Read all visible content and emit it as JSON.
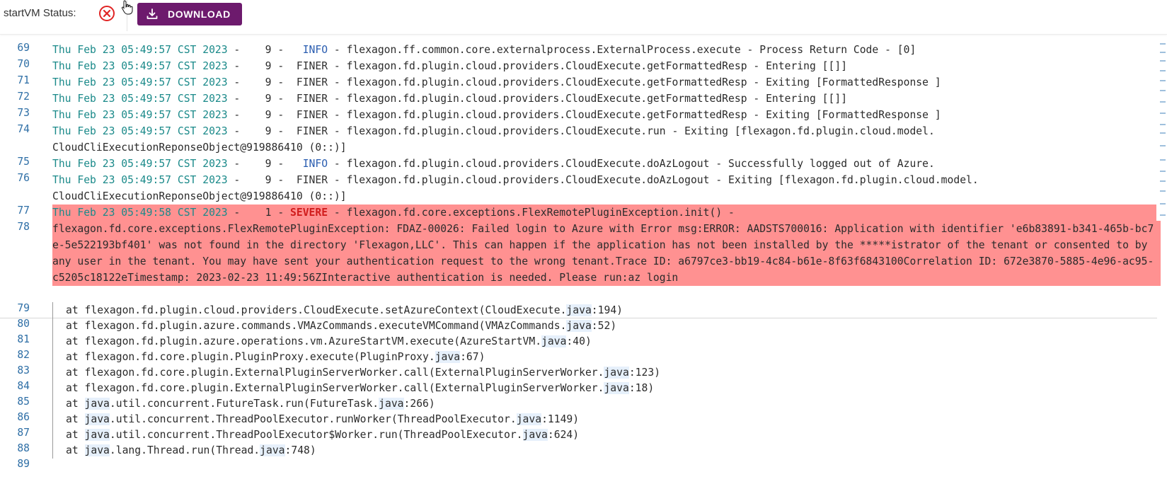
{
  "header": {
    "status_label": "startVM Status:",
    "status_icon": "error-circle-x-icon",
    "download_label": "DOWNLOAD",
    "download_icon": "download-icon"
  },
  "colors": {
    "brand": "#6d1a6d",
    "error": "#e02424",
    "severe_bg": "#ff9191",
    "timestamp": "#1b8a8a",
    "line_number": "#2f6fa6"
  },
  "log": {
    "lines": [
      {
        "n": "69",
        "ts": "Thu Feb 23 05:49:57 CST 2023",
        "thread": " -    9 - ",
        "level": "  INFO",
        "msg": " - flexagon.ff.common.core.externalprocess.ExternalProcess.execute - Process Return Code - [0]"
      },
      {
        "n": "70",
        "ts": "Thu Feb 23 05:49:57 CST 2023",
        "thread": " -    9 - ",
        "level": " FINER",
        "msg": " - flexagon.fd.plugin.cloud.providers.CloudExecute.getFormattedResp - Entering [[]]"
      },
      {
        "n": "71",
        "ts": "Thu Feb 23 05:49:57 CST 2023",
        "thread": " -    9 - ",
        "level": " FINER",
        "msg": " - flexagon.fd.plugin.cloud.providers.CloudExecute.getFormattedResp - Exiting [FormattedResponse ]"
      },
      {
        "n": "72",
        "ts": "Thu Feb 23 05:49:57 CST 2023",
        "thread": " -    9 - ",
        "level": " FINER",
        "msg": " - flexagon.fd.plugin.cloud.providers.CloudExecute.getFormattedResp - Entering [[]]"
      },
      {
        "n": "73",
        "ts": "Thu Feb 23 05:49:57 CST 2023",
        "thread": " -    9 - ",
        "level": " FINER",
        "msg": " - flexagon.fd.plugin.cloud.providers.CloudExecute.getFormattedResp - Exiting [FormattedResponse ]"
      },
      {
        "n": "74",
        "ts": "Thu Feb 23 05:49:57 CST 2023",
        "thread": " -    9 - ",
        "level": " FINER",
        "msg": " - flexagon.fd.plugin.cloud.providers.CloudExecute.run - Exiting [flexagon.fd.plugin.cloud.model.",
        "cont": "CloudCliExecutionReponseObject@919886410 (0::)]"
      },
      {
        "n": "75",
        "ts": "Thu Feb 23 05:49:57 CST 2023",
        "thread": " -    9 - ",
        "level": "  INFO",
        "msg": " - flexagon.fd.plugin.cloud.providers.CloudExecute.doAzLogout - Successfully logged out of Azure."
      },
      {
        "n": "76",
        "ts": "Thu Feb 23 05:49:57 CST 2023",
        "thread": " -    9 - ",
        "level": " FINER",
        "msg": " - flexagon.fd.plugin.cloud.providers.CloudExecute.doAzLogout - Exiting [flexagon.fd.plugin.cloud.model.",
        "cont": "CloudCliExecutionReponseObject@919886410 (0::)]"
      },
      {
        "n": "77",
        "ts": "Thu Feb 23 05:49:58 CST 2023",
        "thread": " -    1 - ",
        "level": "SEVERE",
        "msg": " - flexagon.fd.core.exceptions.FlexRemotePluginException.init() -"
      }
    ],
    "severe_detail": {
      "n": "78",
      "text": "flexagon.fd.core.exceptions.FlexRemotePluginException: FDAZ-00026: Failed login to Azure with Error msg:ERROR: AADSTS700016: Application with identifier 'e6b83891-b341-465b-bc7e-5e522193bf401' was not found in the directory 'Flexagon,LLC'. This can happen if the application has not been installed by the *****istrator of the tenant or consented to by any user in the tenant. You may have sent your authentication request to the wrong tenant.Trace ID: a6797ce3-bb19-4c84-b61e-8f63f6843100Correlation ID: 672e3870-5885-4e96-ac95-c5205c18122eTimestamp: 2023-02-23 11:49:56ZInteractive authentication is needed. Please run:az login"
    },
    "stack": [
      {
        "n": "79",
        "pre": "at flexagon.fd.plugin.cloud.providers.CloudExecute.setAzureContext(CloudExecute.",
        "j": "java",
        "post": ":194)"
      },
      {
        "n": "80",
        "pre": "at flexagon.fd.plugin.azure.commands.VMAzCommands.executeVMCommand(VMAzCommands.",
        "j": "java",
        "post": ":52)"
      },
      {
        "n": "81",
        "pre": "at flexagon.fd.plugin.azure.operations.vm.AzureStartVM.execute(AzureStartVM.",
        "j": "java",
        "post": ":40)"
      },
      {
        "n": "82",
        "pre": "at flexagon.fd.core.plugin.PluginProxy.execute(PluginProxy.",
        "j": "java",
        "post": ":67)"
      },
      {
        "n": "83",
        "pre": "at flexagon.fd.core.plugin.ExternalPluginServerWorker.call(ExternalPluginServerWorker.",
        "j": "java",
        "post": ":123)"
      },
      {
        "n": "84",
        "pre": "at flexagon.fd.core.plugin.ExternalPluginServerWorker.call(ExternalPluginServerWorker.",
        "j": "java",
        "post": ":18)"
      },
      {
        "n": "85",
        "pre": "at ",
        "j0": "java",
        "mid": ".util.concurrent.FutureTask.run(FutureTask.",
        "j": "java",
        "post": ":266)"
      },
      {
        "n": "86",
        "pre": "at ",
        "j0": "java",
        "mid": ".util.concurrent.ThreadPoolExecutor.runWorker(ThreadPoolExecutor.",
        "j": "java",
        "post": ":1149)"
      },
      {
        "n": "87",
        "pre": "at ",
        "j0": "java",
        "mid": ".util.concurrent.ThreadPoolExecutor$Worker.run(ThreadPoolExecutor.",
        "j": "java",
        "post": ":624)"
      },
      {
        "n": "88",
        "pre": "at ",
        "j0": "java",
        "mid": ".lang.Thread.run(Thread.",
        "j": "java",
        "post": ":748)"
      }
    ],
    "last_line_number": "89"
  }
}
